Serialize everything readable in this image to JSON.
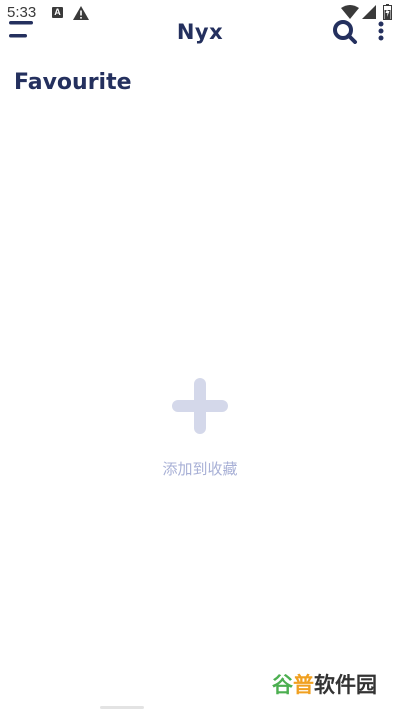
{
  "status_bar": {
    "time": "5:33",
    "notification_letter": "A",
    "icons": [
      "notification-a-icon",
      "warning-icon",
      "wifi-icon",
      "signal-icon",
      "battery-icon"
    ]
  },
  "app_bar": {
    "title": "Nyx",
    "icons": [
      "menu-icon",
      "search-icon",
      "more-vertical-icon"
    ]
  },
  "page": {
    "title": "Favourite"
  },
  "empty_state": {
    "icon": "plus-icon",
    "label": "添加到收藏"
  },
  "watermark": {
    "part1": "谷",
    "part2": "普",
    "part3": "软件园"
  },
  "colors": {
    "primary": "#24305e",
    "muted_accent": "#a8b0d6",
    "plus_fill": "#d4d8ea",
    "background": "#ffffff"
  }
}
